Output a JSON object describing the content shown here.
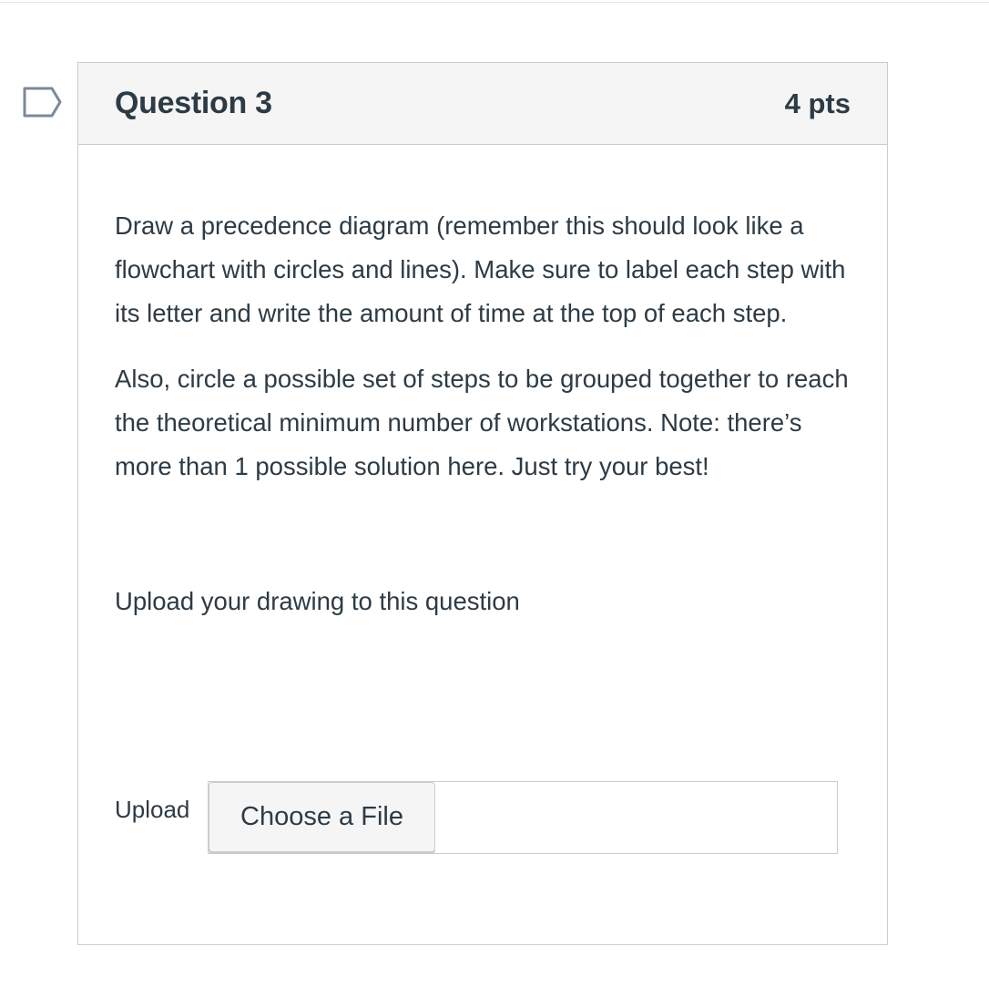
{
  "question": {
    "title": "Question 3",
    "points": "4 pts",
    "paragraphs": [
      "Draw a precedence diagram (remember this should look like a flowchart with circles and lines). Make sure to label each step with its letter and write the amount of time at the top of each step.",
      "Also, circle a possible set of steps to be grouped together to reach the theoretical minimum number of workstations. Note: there’s more than 1 possible solution here. Just try your best!"
    ],
    "upload_prompt": "Upload your drawing to this question",
    "upload_label": "Upload",
    "file_button_label": "Choose a File"
  },
  "icons": {
    "flag": "flag-icon"
  },
  "colors": {
    "text": "#2d3b45",
    "border": "#c7cdd1",
    "header_bg": "#f5f5f5",
    "flag_stroke": "#7b8a99"
  }
}
